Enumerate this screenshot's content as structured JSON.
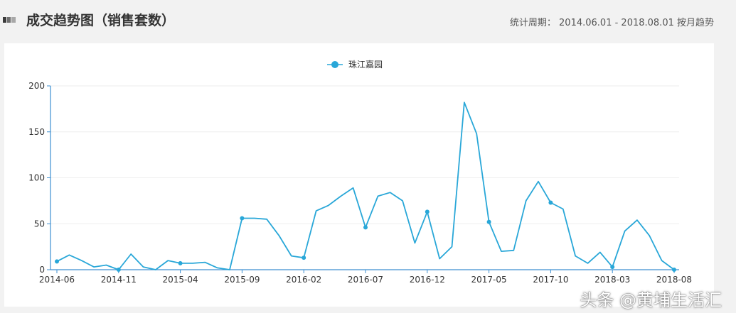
{
  "header": {
    "title": "成交趋势图（销售套数）",
    "period": "统计周期： 2014.06.01 - 2018.08.01 按月趋势"
  },
  "watermark": "头条 @黄埔生活汇",
  "colors": {
    "series": "#29a7d8",
    "axis": "#3d8fd1",
    "grid": "#eeeeee"
  },
  "chart_data": {
    "type": "line",
    "title": "",
    "xlabel": "",
    "ylabel": "",
    "ylim": [
      0,
      200
    ],
    "yticks": [
      0,
      50,
      100,
      150,
      200
    ],
    "legend_position": "top-center",
    "grid": true,
    "xtick_labels": [
      "2014-06",
      "2014-11",
      "2015-04",
      "2015-09",
      "2016-02",
      "2016-07",
      "2016-12",
      "2017-05",
      "2017-10",
      "2018-03",
      "2018-08"
    ],
    "categories": [
      "2014-06",
      "2014-07",
      "2014-08",
      "2014-09",
      "2014-10",
      "2014-11",
      "2014-12",
      "2015-01",
      "2015-02",
      "2015-03",
      "2015-04",
      "2015-05",
      "2015-06",
      "2015-07",
      "2015-08",
      "2015-09",
      "2015-10",
      "2015-11",
      "2015-12",
      "2016-01",
      "2016-02",
      "2016-03",
      "2016-04",
      "2016-05",
      "2016-06",
      "2016-07",
      "2016-08",
      "2016-09",
      "2016-10",
      "2016-11",
      "2016-12",
      "2017-01",
      "2017-02",
      "2017-03",
      "2017-04",
      "2017-05",
      "2017-06",
      "2017-07",
      "2017-08",
      "2017-09",
      "2017-10",
      "2017-11",
      "2017-12",
      "2018-01",
      "2018-02",
      "2018-03",
      "2018-04",
      "2018-05",
      "2018-06",
      "2018-07",
      "2018-08"
    ],
    "series": [
      {
        "name": "珠江嘉园",
        "values": [
          9,
          16,
          10,
          3,
          5,
          0,
          17,
          3,
          0,
          10,
          7,
          7,
          8,
          2,
          0,
          56,
          56,
          55,
          37,
          15,
          13,
          64,
          70,
          80,
          89,
          46,
          80,
          84,
          75,
          29,
          63,
          12,
          25,
          182,
          148,
          52,
          20,
          21,
          75,
          96,
          73,
          66,
          15,
          7,
          19,
          3,
          42,
          54,
          37,
          10,
          0
        ],
        "markers": [
          0,
          5,
          10,
          15,
          20,
          25,
          30,
          35,
          40,
          45,
          50
        ]
      }
    ]
  }
}
